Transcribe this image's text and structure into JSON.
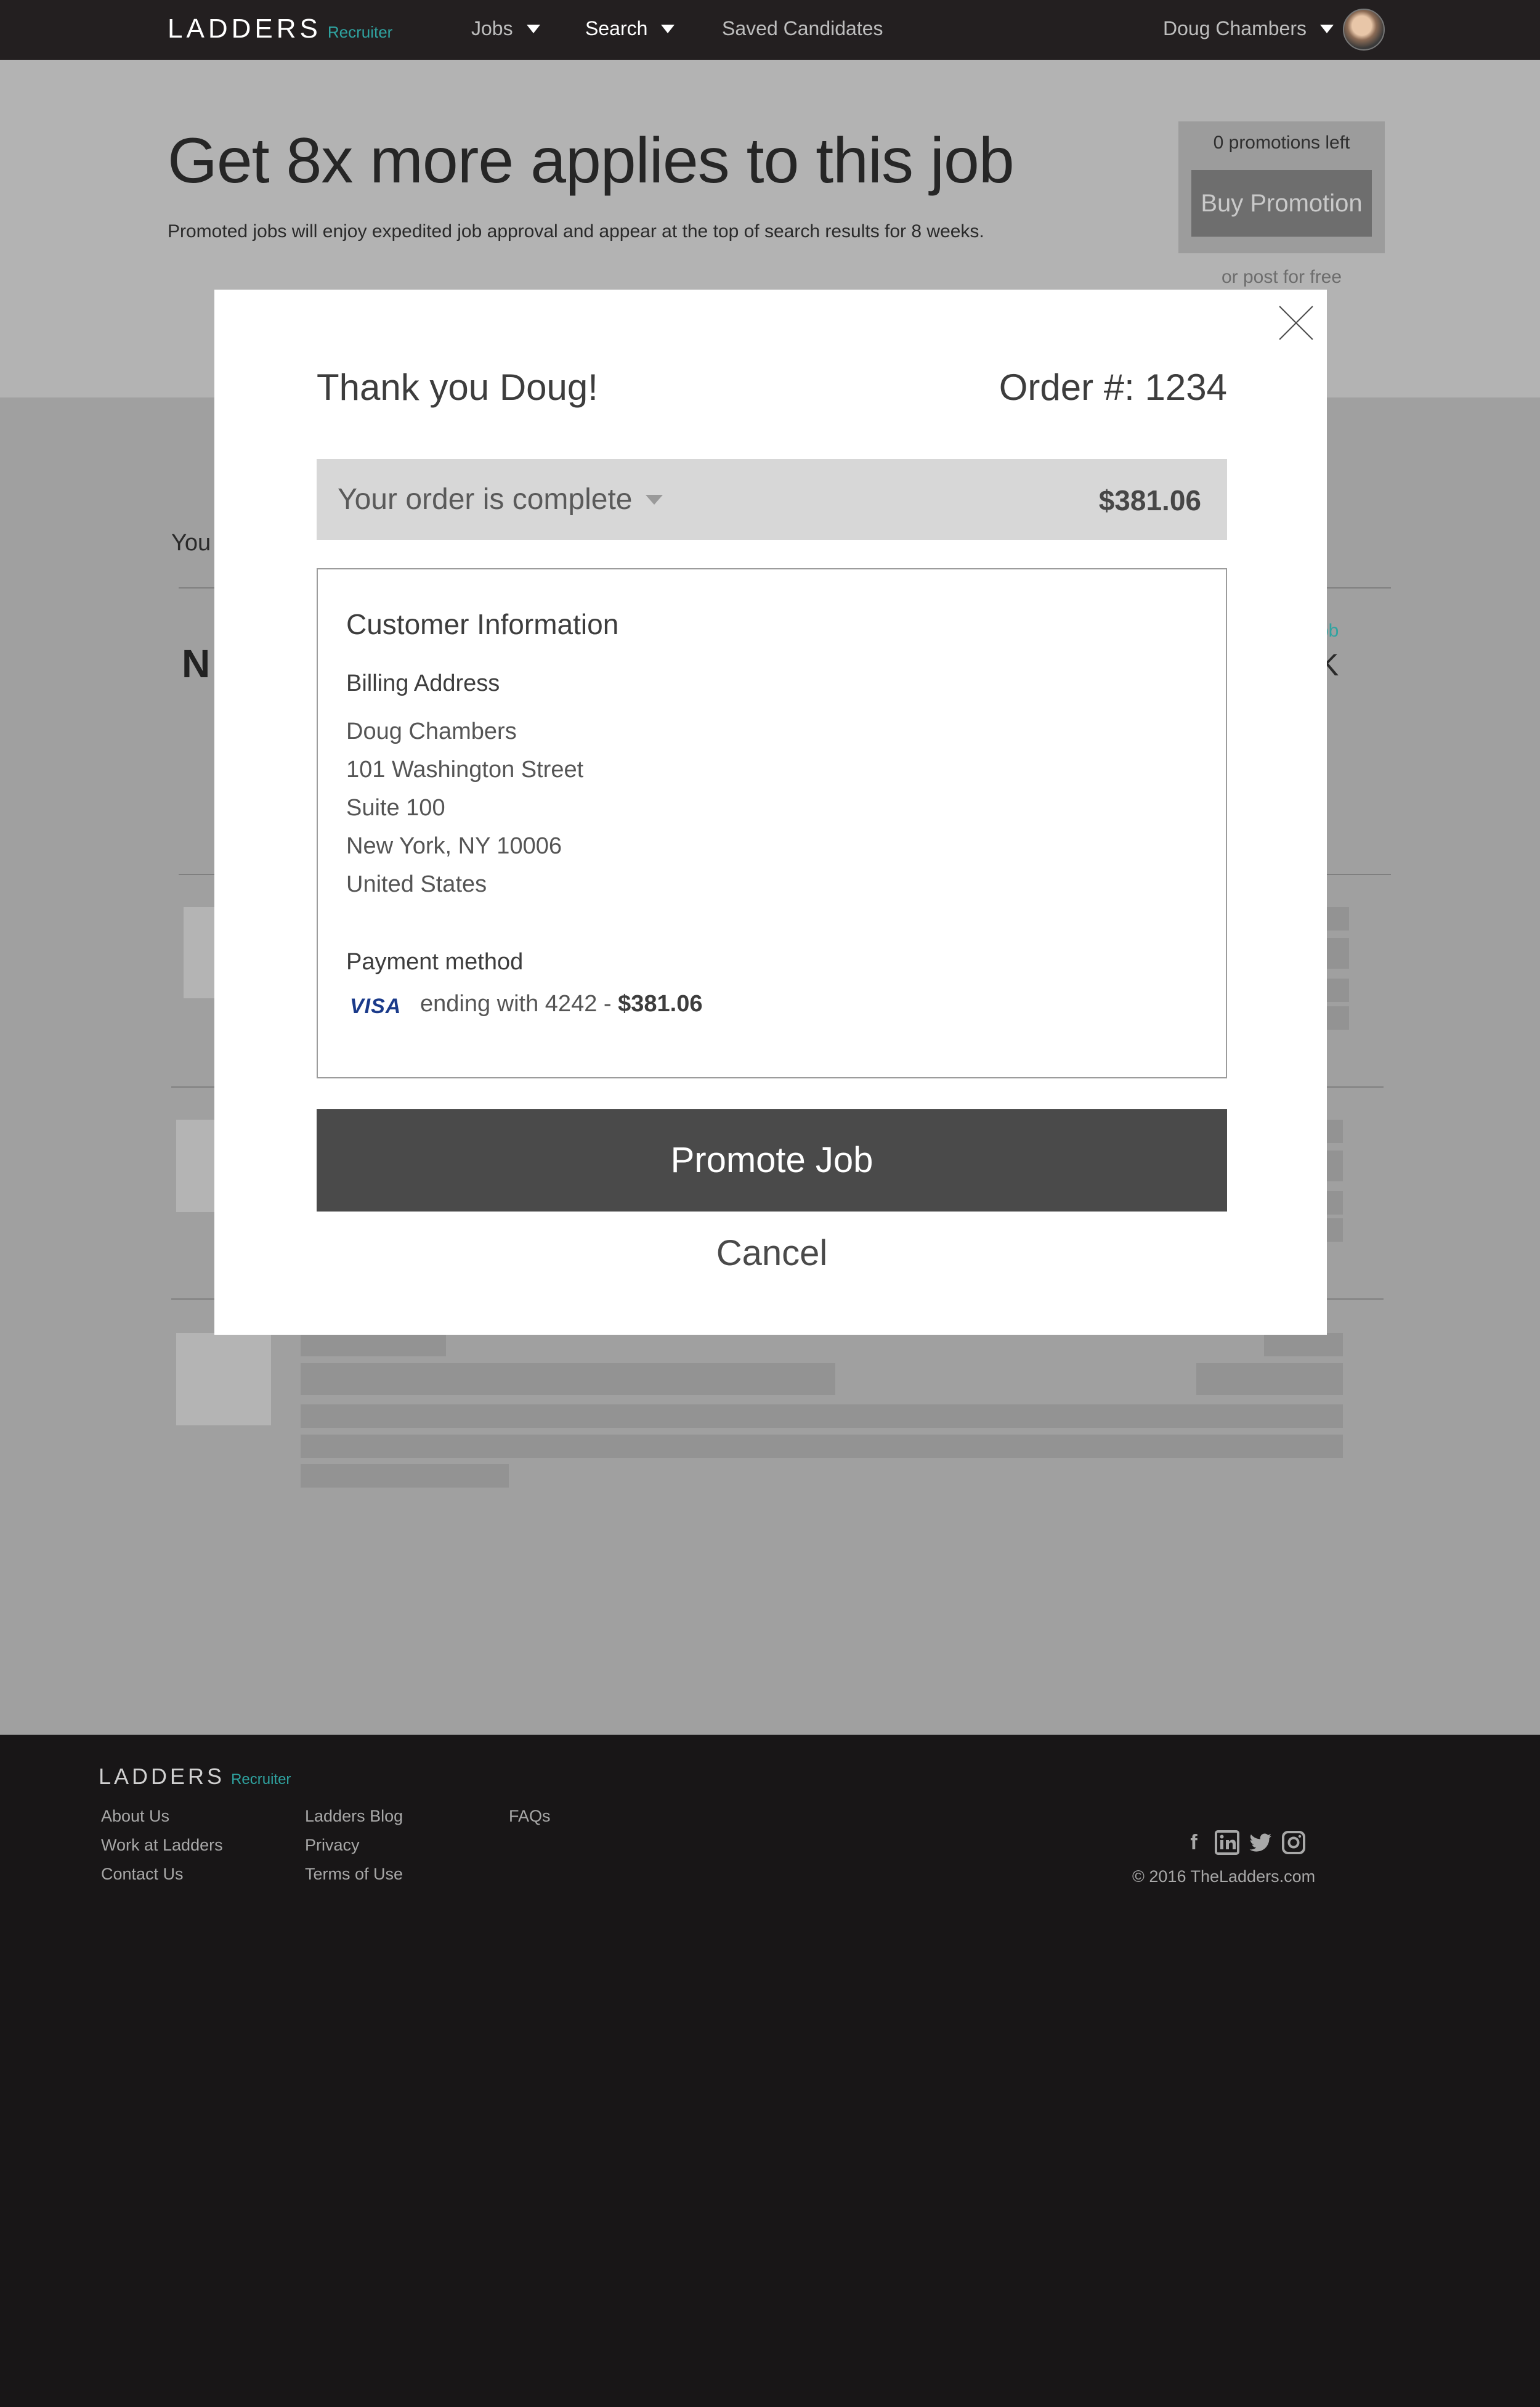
{
  "brand": {
    "wordmark": "LADDERS",
    "product": "Recruiter",
    "accent_color": "#2fa3a0"
  },
  "nav": {
    "items": [
      {
        "label": "Jobs",
        "has_dropdown": true
      },
      {
        "label": "Search",
        "has_dropdown": true
      },
      {
        "label": "Saved Candidates",
        "has_dropdown": false
      }
    ],
    "user_name": "Doug Chambers"
  },
  "hero": {
    "title": "Get 8x more applies to this job",
    "subtitle": "Promoted jobs will enjoy expedited job approval and appear at the top of search results for 8 weeks.",
    "promotions_left": "0 promotions left",
    "buy_button": "Buy Promotion",
    "post_free": "or post for free"
  },
  "background_fragments": {
    "you": "You",
    "logo_letter": "N",
    "right_link": "ob",
    "right_letter": "K"
  },
  "modal": {
    "thank_you": "Thank you Doug!",
    "order_number": "Order #: 1234",
    "status_text": "Your order is complete",
    "status_amount": "$381.06",
    "customer_info_title": "Customer Information",
    "billing_title": "Billing Address",
    "address_lines": [
      "Doug Chambers",
      "101 Washington Street",
      "Suite 100",
      "New York, NY 10006",
      "United States"
    ],
    "payment_title": "Payment method",
    "card_brand": "VISA",
    "card_ending": "ending with 4242 -",
    "payment_amount": "$381.06",
    "primary_button": "Promote Job",
    "cancel_button": "Cancel"
  },
  "footer": {
    "col1": [
      "About Us",
      "Work at Ladders",
      "Contact Us"
    ],
    "col2": [
      "Ladders Blog",
      "Privacy",
      "Terms of Use"
    ],
    "col3": [
      "FAQs"
    ],
    "social_icons": [
      "facebook-icon",
      "linkedin-icon",
      "twitter-icon",
      "instagram-icon"
    ],
    "copyright": "© 2016 TheLadders.com"
  }
}
